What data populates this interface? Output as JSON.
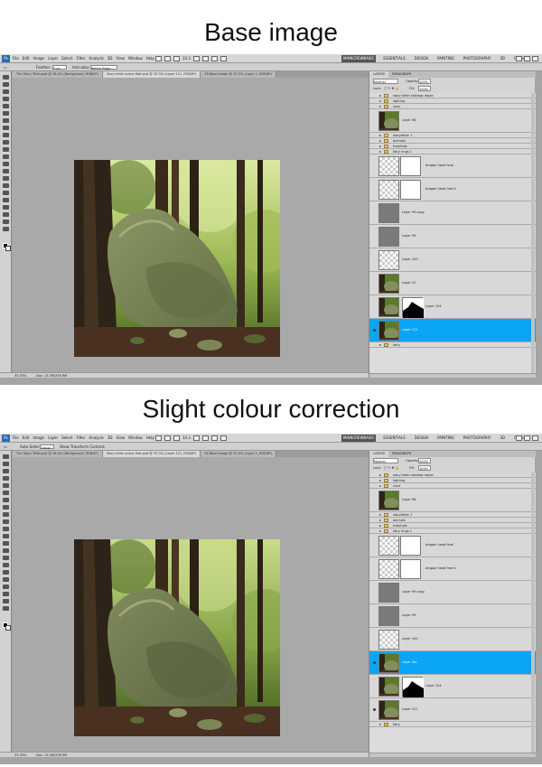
{
  "headings": {
    "top": "Base image",
    "bottom": "Slight colour correction"
  },
  "app": {
    "logo": "Ps",
    "menus": [
      "File",
      "Edit",
      "Image",
      "Layer",
      "Select",
      "Filter",
      "Analysis",
      "3D",
      "View",
      "Window",
      "Help"
    ],
    "workspaces": [
      "MAINCREWBASIC",
      "ESSENTIALS",
      "DESIGN",
      "PAINTING",
      "PHOTOGRAPHY",
      "3D",
      "CS Live"
    ]
  },
  "screens": [
    {
      "zoom_field": "33.3",
      "options": {
        "feather_label": "Feather:",
        "feather_value": "0 px",
        "antialias": "Anti-alias",
        "refine_edge": "Refine Edge..."
      },
      "tabs": [
        {
          "label": "The Story Teller.psd @ 38.4% (Background, RGB/8*)",
          "active": false
        },
        {
          "label": "Story teller scene flatt.psd @ 33.3% (Layer 121, RGB/8*)",
          "active": true
        },
        {
          "label": "SS Base image @ 33.3% (Layer 1, RGB/8*)",
          "active": false
        }
      ],
      "status": {
        "zoom": "33.33%",
        "doc": "Doc: 13.3M/378.9M"
      },
      "panel": {
        "tabs": [
          "LAYERS",
          "PARAGRAPH"
        ],
        "blend": "Normal",
        "opacity_label": "Opacity:",
        "opacity": "100%",
        "lock_label": "Lock:",
        "fill_label": "Fill:",
        "fill": "100%"
      },
      "layers": [
        {
          "name": "story teller shadow repair",
          "kind": "group"
        },
        {
          "name": "lighting",
          "kind": "group"
        },
        {
          "name": "xxxx",
          "kind": "group"
        },
        {
          "name": "Layer 98",
          "kind": "photo"
        },
        {
          "name": "storyteller 1",
          "kind": "group"
        },
        {
          "name": "animals",
          "kind": "group"
        },
        {
          "name": "tree/hole",
          "kind": "group"
        },
        {
          "name": "fairy rings 1",
          "kind": "group"
        },
        {
          "name": "dragon head final",
          "kind": "mask"
        },
        {
          "name": "dragon head free it",
          "kind": "mask"
        },
        {
          "name": "Layer 99 copy",
          "kind": "gray"
        },
        {
          "name": "Layer 99",
          "kind": "gray"
        },
        {
          "name": "Layer 100",
          "kind": "checker"
        },
        {
          "name": "Layer 31",
          "kind": "photo"
        },
        {
          "name": "Layer 124",
          "kind": "photomask"
        },
        {
          "name": "Layer 121",
          "kind": "photo",
          "selected": true
        },
        {
          "name": "fairy",
          "kind": "group"
        }
      ]
    },
    {
      "zoom_field": "33.3",
      "options": {
        "auto_select": "Auto-Select:",
        "auto_select_value": "Group",
        "transform": "Show Transform Controls"
      },
      "tabs": [
        {
          "label": "The Story Teller.psd @ 38.4% (Background, RGB/8*)",
          "active": false
        },
        {
          "label": "Story teller scene flatt.psd @ 33.3% (Layer 121, RGB/8*)",
          "active": true
        },
        {
          "label": "SS Base image @ 33.3% (Layer 1, RGB/8*)",
          "active": false
        }
      ],
      "status": {
        "zoom": "33.33%",
        "doc": "Doc: 13.3M/378.9M"
      },
      "panel": {
        "tabs": [
          "LAYERS",
          "PARAGRAPH"
        ],
        "blend": "Normal",
        "opacity_label": "Opacity:",
        "opacity": "100%",
        "lock_label": "Lock:",
        "fill_label": "Fill:",
        "fill": "100%"
      },
      "layers": [
        {
          "name": "story teller shadow repair",
          "kind": "group"
        },
        {
          "name": "lighting",
          "kind": "group"
        },
        {
          "name": "xxxx",
          "kind": "group"
        },
        {
          "name": "Layer 98",
          "kind": "photo"
        },
        {
          "name": "storyteller 1",
          "kind": "group"
        },
        {
          "name": "animals",
          "kind": "group"
        },
        {
          "name": "tree/hole",
          "kind": "group"
        },
        {
          "name": "fairy rings 1",
          "kind": "group"
        },
        {
          "name": "dragon head final",
          "kind": "mask"
        },
        {
          "name": "dragon head free it",
          "kind": "mask"
        },
        {
          "name": "Layer 99 copy",
          "kind": "gray"
        },
        {
          "name": "Layer 99",
          "kind": "gray"
        },
        {
          "name": "Layer 100",
          "kind": "checker"
        },
        {
          "name": "Layer 3m",
          "kind": "photo",
          "selected": true
        },
        {
          "name": "Layer 124",
          "kind": "photomask"
        },
        {
          "name": "Layer 121",
          "kind": "photo"
        },
        {
          "name": "fairy",
          "kind": "group"
        }
      ]
    }
  ]
}
